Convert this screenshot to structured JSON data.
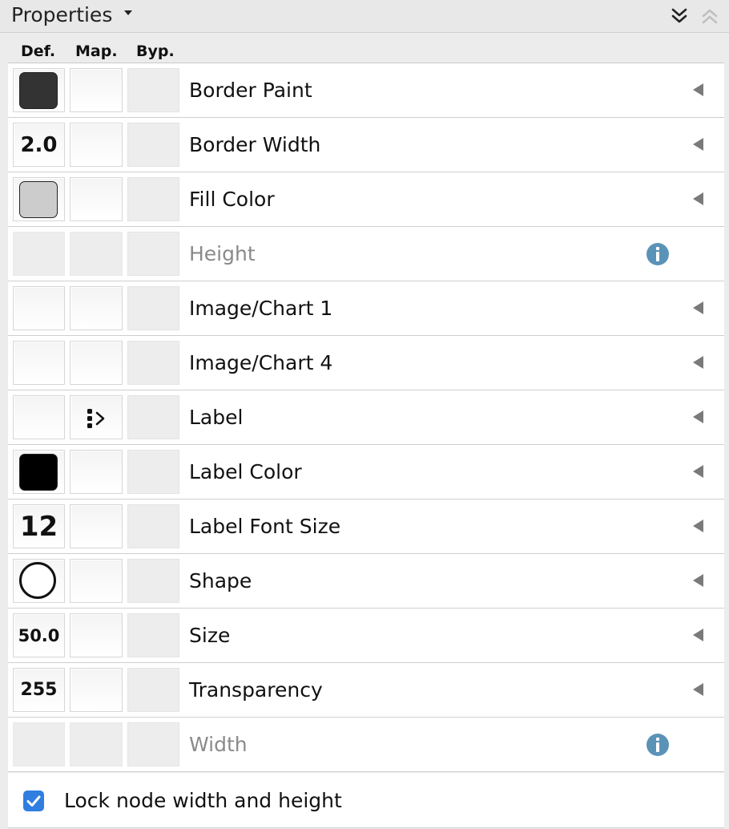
{
  "header": {
    "title": "Properties",
    "dropdown_icon": "caret-down-icon",
    "collapse_icon": "double-chevron-down-icon",
    "expand_icon": "double-chevron-up-icon"
  },
  "columns": {
    "def": "Def.",
    "map": "Map.",
    "byp": "Byp."
  },
  "properties": [
    {
      "name": "Border Paint",
      "def_kind": "swatch",
      "def_color": "#333333",
      "enabled": true
    },
    {
      "name": "Border Width",
      "def_kind": "text",
      "def_text": "2.0",
      "enabled": true
    },
    {
      "name": "Fill Color",
      "def_kind": "swatch",
      "def_color": "#cccccc",
      "enabled": true
    },
    {
      "name": "Height",
      "def_kind": "none",
      "enabled": false
    },
    {
      "name": "Image/Chart 1",
      "def_kind": "empty",
      "enabled": true
    },
    {
      "name": "Image/Chart 4",
      "def_kind": "empty",
      "enabled": true
    },
    {
      "name": "Label",
      "def_kind": "empty",
      "mapping_icon": "passthrough-mapping-icon",
      "enabled": true
    },
    {
      "name": "Label Color",
      "def_kind": "swatch",
      "def_color": "#000000",
      "enabled": true
    },
    {
      "name": "Label Font Size",
      "def_kind": "text",
      "def_text": "12",
      "enabled": true
    },
    {
      "name": "Shape",
      "def_kind": "ellipse",
      "enabled": true
    },
    {
      "name": "Size",
      "def_kind": "text",
      "def_text": "50.0",
      "enabled": true
    },
    {
      "name": "Transparency",
      "def_kind": "text",
      "def_text": "255",
      "enabled": true
    },
    {
      "name": "Width",
      "def_kind": "none",
      "enabled": false
    }
  ],
  "lock": {
    "label": "Lock node width and height",
    "checked": true
  },
  "colors": {
    "accent": "#2f7ee0",
    "info": "#5b93b8",
    "disabled_text": "#8a8a8a"
  }
}
